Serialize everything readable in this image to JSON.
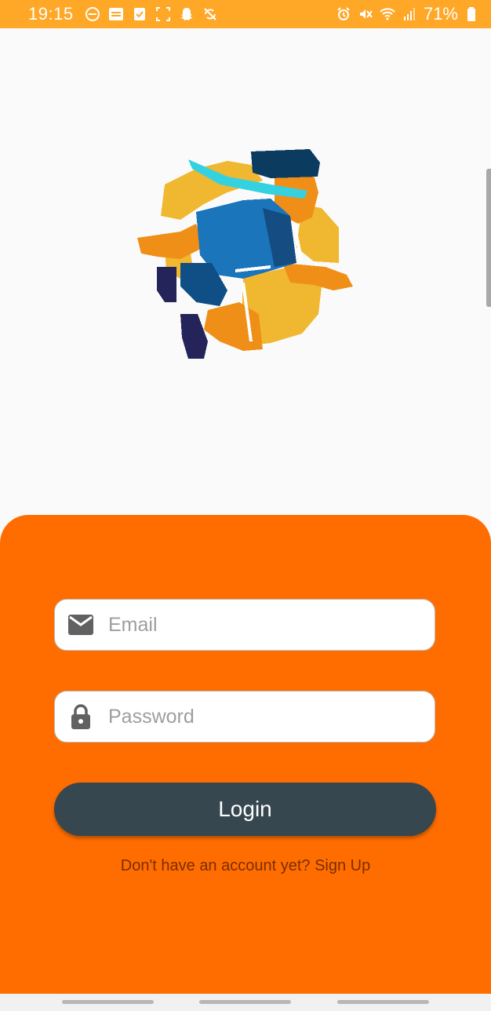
{
  "status_bar": {
    "time": "19:15",
    "battery": "71%",
    "background": "#ffa726"
  },
  "login": {
    "email_placeholder": "Email",
    "password_placeholder": "Password",
    "login_button": "Login",
    "signup_text": "Don't have an account yet? Sign Up"
  },
  "colors": {
    "panel": "#ff6d00",
    "button": "#37474f",
    "signup_text": "#7a2e00"
  }
}
